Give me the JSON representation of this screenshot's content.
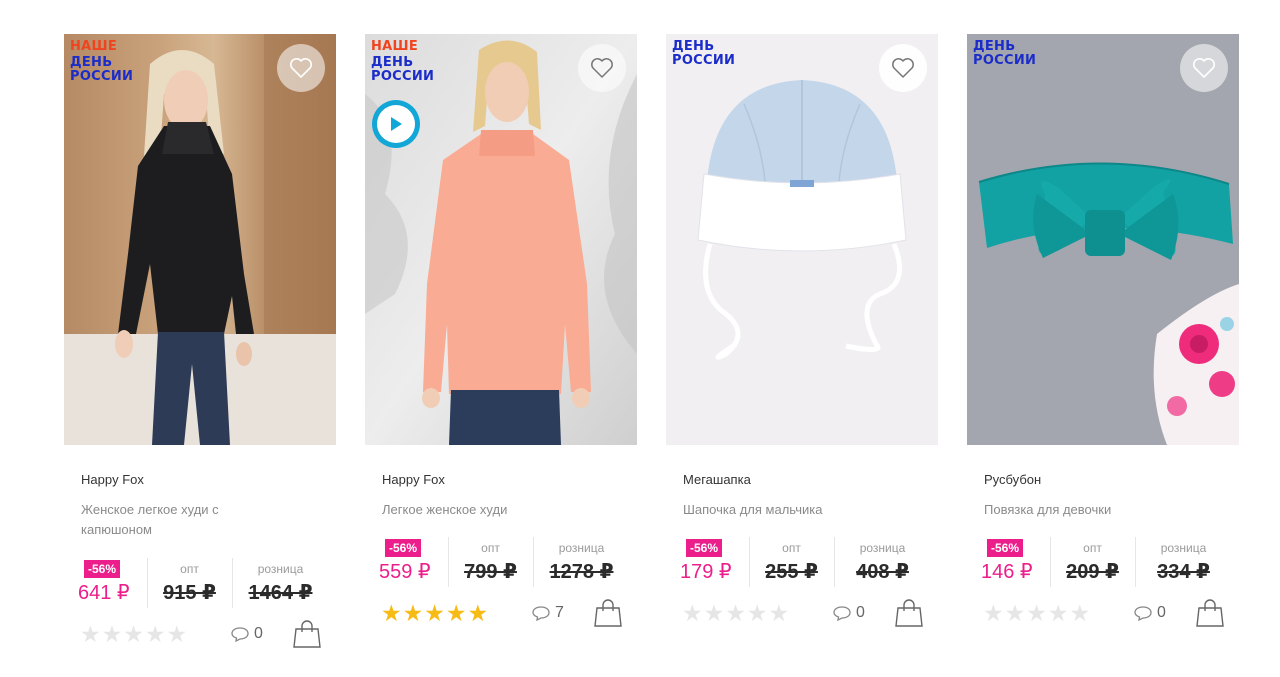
{
  "promo": {
    "line1": "НАШЕ",
    "line2a": "ДЕНЬ",
    "line2b": "РОССИИ"
  },
  "labels": {
    "opt": "опт",
    "retail": "розница"
  },
  "products": [
    {
      "brand": "Happy Fox",
      "title": "Женское легкое худи с капюшоном",
      "discount": "-56%",
      "price": "641 ₽",
      "opt_price": "915 ₽",
      "retail_price": "1464 ₽",
      "rating": 0,
      "comments": "0",
      "image": "woman-black-hoodie"
    },
    {
      "brand": "Happy Fox",
      "title": "Легкое женское худи",
      "discount": "-56%",
      "price": "559 ₽",
      "opt_price": "799 ₽",
      "retail_price": "1278 ₽",
      "rating": 5,
      "comments": "7",
      "image": "woman-pink-hoodie"
    },
    {
      "brand": "Мегашапка",
      "title": "Шапочка для мальчика",
      "discount": "-56%",
      "price": "179 ₽",
      "opt_price": "255 ₽",
      "retail_price": "408 ₽",
      "rating": 0,
      "comments": "0",
      "image": "baby-hat"
    },
    {
      "brand": "Русбубон",
      "title": "Повязка для девочки",
      "discount": "-56%",
      "price": "146 ₽",
      "opt_price": "209 ₽",
      "retail_price": "334 ₽",
      "rating": 0,
      "comments": "0",
      "image": "teal-headband"
    }
  ],
  "colors": {
    "sale": "#ec1e8c",
    "promo_red": "#f0441f",
    "promo_blue": "#1a2cc9",
    "star": "#f7bb15",
    "play": "#12a7d6"
  }
}
